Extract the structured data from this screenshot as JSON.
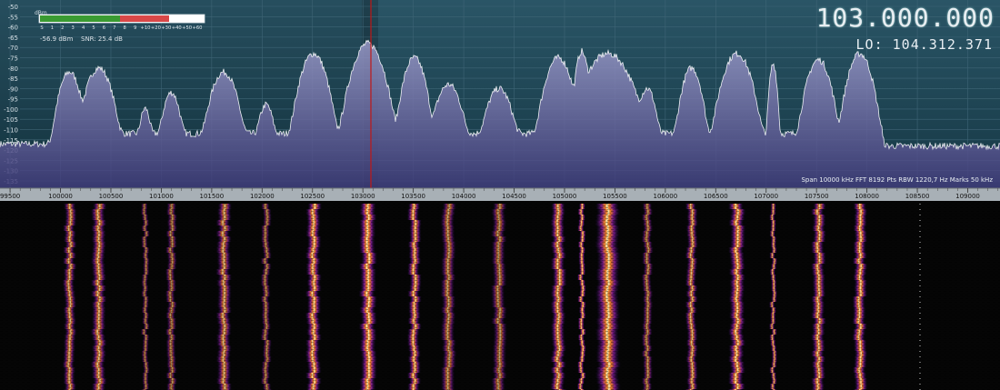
{
  "spectrum": {
    "y_unit": "dBm",
    "y_ticks": [
      "-50",
      "-55",
      "-60",
      "-65",
      "-70",
      "-75",
      "-80",
      "-85",
      "-90",
      "-95",
      "-100",
      "-105",
      "-110",
      "-115",
      "-120",
      "-125",
      "-130",
      "-135"
    ],
    "x_ticks": [
      "99500",
      "100000",
      "100500",
      "101000",
      "101500",
      "102000",
      "102500",
      "103000",
      "103500",
      "104000",
      "104500",
      "105000",
      "105500",
      "106000",
      "106500",
      "107000",
      "107500",
      "108000",
      "108500",
      "109000"
    ],
    "colors": {
      "background": "#1f4656",
      "fill": "#6e6e9e",
      "trace": "#ffffff",
      "grid": "#3d6373",
      "marker": "#c01818"
    }
  },
  "smeter": {
    "unit": "dBm",
    "scale": [
      "S",
      "1",
      "2",
      "3",
      "4",
      "5",
      "6",
      "7",
      "8",
      "9",
      "+10",
      "+20",
      "+30",
      "+40",
      "+50",
      "+60"
    ],
    "level_dbm": -56.9,
    "value": "-56.9 dBm",
    "snr": "SNR: 25.4 dB"
  },
  "frequency": {
    "main": "103.000.000",
    "lo": "LO: 104.312.371"
  },
  "fft_info": {
    "text": "Span 10000 kHz  FFT 8192 Pts  RBW 1220,7 Hz  Marks 50 kHz"
  },
  "stations": [
    {
      "f": 100090,
      "peak": -82,
      "w": 110
    },
    {
      "f": 100380,
      "peak": -80,
      "w": 130
    },
    {
      "f": 100840,
      "peak": -100,
      "w": 60
    },
    {
      "f": 101100,
      "peak": -92,
      "w": 90
    },
    {
      "f": 101620,
      "peak": -82,
      "w": 130
    },
    {
      "f": 102040,
      "peak": -98,
      "w": 80
    },
    {
      "f": 102510,
      "peak": -73,
      "w": 130
    },
    {
      "f": 103050,
      "peak": -68,
      "w": 150
    },
    {
      "f": 103510,
      "peak": -75,
      "w": 110
    },
    {
      "f": 103850,
      "peak": -88,
      "w": 130
    },
    {
      "f": 104350,
      "peak": -90,
      "w": 130
    },
    {
      "f": 104940,
      "peak": -75,
      "w": 130
    },
    {
      "f": 105170,
      "peak": -72,
      "w": 60
    },
    {
      "f": 105430,
      "peak": -73,
      "w": 220
    },
    {
      "f": 105820,
      "peak": -90,
      "w": 90
    },
    {
      "f": 106260,
      "peak": -80,
      "w": 100
    },
    {
      "f": 106710,
      "peak": -73,
      "w": 140
    },
    {
      "f": 107070,
      "peak": -78,
      "w": 40
    },
    {
      "f": 107520,
      "peak": -76,
      "w": 120
    },
    {
      "f": 107930,
      "peak": -73,
      "w": 120
    }
  ]
}
